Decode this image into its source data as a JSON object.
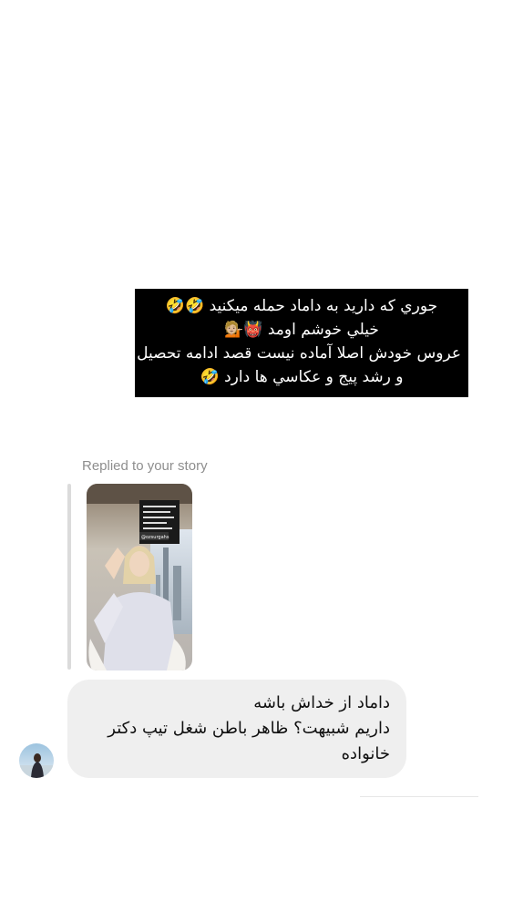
{
  "story_caption": {
    "lines": [
      "جوري كه داريد به داماد حمله ميكنيد 🤣🤣",
      "خيلي خوشم اومد 👹💁🏼",
      "عروس خودش اصلا آماده نيست قصد ادامه تحصيل",
      "و رشد پيج و عكاسي ها دارد 🤣"
    ]
  },
  "reply": {
    "label": "Replied to your story",
    "story_overlay_text": "@ozsurgahs"
  },
  "message": {
    "lines": [
      "داماد از خداش باشه",
      "داريم شبيهت؟ ظاهر باطن شغل تيپ دكتر",
      "خانواده"
    ]
  },
  "colors": {
    "caption_bg": "#000000",
    "bubble_bg": "#efefef",
    "label_gray": "#8e8e8e"
  }
}
